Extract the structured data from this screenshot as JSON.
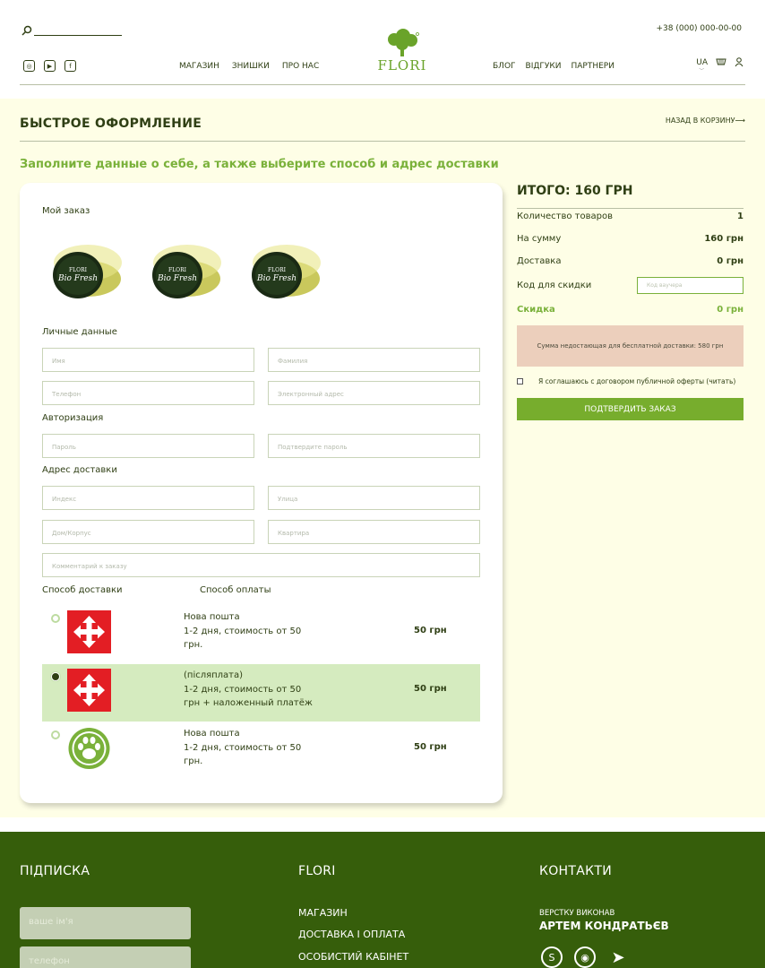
{
  "header": {
    "phone": "+38 (000) 000-00-00",
    "brand": "FLORI",
    "nav_left": [
      "МАГАЗИН",
      "ЗНИШКИ",
      "ПРО НАС"
    ],
    "nav_right": [
      "БЛОГ",
      "ВІДГУКИ",
      "ПАРТНЕРИ"
    ],
    "language": "UA",
    "social_icons": [
      "instagram-icon",
      "youtube-icon",
      "facebook-icon"
    ]
  },
  "page": {
    "title": "БЫСТРОЕ ОФОРМЛЕНИЕ",
    "back_link": "НАЗАД В КОРЗИНУ⟶",
    "subtitle": "Заполните данные о себе, а также выберите способ и адрес доставки"
  },
  "order": {
    "my_order_label": "Мой заказ",
    "product_label": "Bio Fresh",
    "personal_label": "Личные данные",
    "auth_label": "Авторизация",
    "address_label": "Адрес доставки",
    "fields": {
      "first_name": "Имя",
      "last_name": "Фамилия",
      "phone": "Телефон",
      "email": "Электронный адрес",
      "password": "Пароль",
      "password_confirm": "Подтвердите пароль",
      "index": "Индекс",
      "street": "Улица",
      "house": "Дом/Корпус",
      "apartment": "Квартира",
      "comment": "Комментарий к заказу"
    },
    "delivery_method_label": "Способ доставки",
    "payment_method_label": "Способ оплаты",
    "delivery_options": [
      {
        "title": "Нова пошта",
        "desc": "1-2 дня, стоимость от 50 грн.",
        "price": "50 грн"
      },
      {
        "title": "(післяплата)",
        "desc": "1-2 дня, стоимость от 50 грн + наложенный платёж",
        "price": "50 грн"
      },
      {
        "title": "Нова пошта",
        "desc": "1-2 дня, стоимость от 50 грн.",
        "price": "50 грн"
      }
    ]
  },
  "summary": {
    "title": "ИТОГО: 160 ГРН",
    "qty_label": "Количество товаров",
    "qty_value": "1",
    "sum_label": "На сумму",
    "sum_value": "160 грн",
    "delivery_label": "Доставка",
    "delivery_value": "0 грн",
    "promo_label": "Код для скидки",
    "promo_placeholder": "Код ваучера",
    "discount_label": "Скидка",
    "discount_value": "0 грн",
    "free_delivery_notice": "Сумма недостающая для бесплатной доставки: 580 грн",
    "agree_text": "Я соглашаюсь с договором публичной оферты (читать)",
    "confirm_label": "ПОДТВЕРДИТЬ ЗАКАЗ"
  },
  "footer": {
    "subscribe_title": "ПІДПИСКА",
    "name_placeholder": "ваше ім'я",
    "phone_placeholder": "телефон",
    "flori_title": "FLORI",
    "links": [
      "МАГАЗИН",
      "ДОСТАВКА І ОПЛАТА",
      "ОСОБИСТИЙ КАБІНЕТ"
    ],
    "contacts_title": "КОНТАКТИ",
    "made_by_label": "ВЕРСТКУ ВИКОНАВ",
    "author": "АРТЕМ КОНДРАТЬЄВ",
    "contact_icons": [
      "skype-icon",
      "github-icon",
      "telegram-icon"
    ]
  },
  "colors": {
    "brand_green": "#7ab13a",
    "dark_green": "#365e0b",
    "text": "#2f3f14",
    "notice_bg": "#eccfbc",
    "selected_row": "#d5ebbf",
    "main_bg": "#fefee6"
  }
}
